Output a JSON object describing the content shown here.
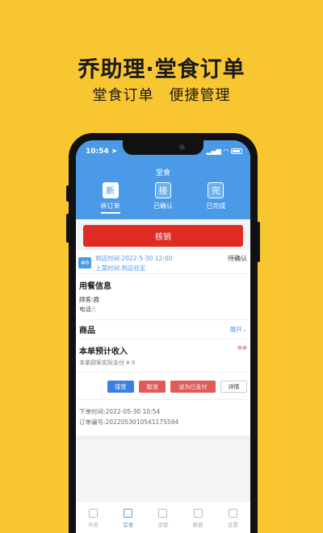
{
  "promo": {
    "title": "乔助理·堂食订单",
    "subtitle": "堂食订单　便捷管理"
  },
  "status_bar": {
    "time": "10:54"
  },
  "header": {
    "title": "堂食"
  },
  "tabs": [
    {
      "icon_char": "新",
      "label": "新订单",
      "active": true
    },
    {
      "icon_char": "接",
      "label": "已确认",
      "active": false
    },
    {
      "icon_char": "完",
      "label": "已完成",
      "active": false
    }
  ],
  "verify_button": "核销",
  "order": {
    "number": "#6",
    "arrival_time": "到店时间:2022-5-30 12:00",
    "serve_time": "上菜时间:到店在定",
    "status": "待确认",
    "dining_info_title": "用餐信息",
    "customer": "顾客:鹿",
    "phone_label": "电话:",
    "phone_value": "\\",
    "goods_title": "商品",
    "expand_label": "展开",
    "income_title": "本单预计收入",
    "income_sub": "本单顾客实际支付 ¥ 0",
    "actions": {
      "accept": "接受",
      "cancel": "取消",
      "set_paid": "设为已支付",
      "detail": "详情"
    },
    "order_time": "下单时间:2022-05-30 10:54",
    "order_no": "订单编号:2022053010541175594"
  },
  "bottom_nav": [
    {
      "label": "外卖",
      "active": false,
      "icon": "takeout-icon"
    },
    {
      "label": "堂食",
      "active": true,
      "icon": "dine-in-icon"
    },
    {
      "label": "运营",
      "active": false,
      "icon": "operation-icon"
    },
    {
      "label": "数据",
      "active": false,
      "icon": "data-icon"
    },
    {
      "label": "设置",
      "active": false,
      "icon": "settings-icon"
    }
  ],
  "colors": {
    "background": "#F7C630",
    "header_blue": "#4A9AE8",
    "verify_red": "#E02B24"
  }
}
